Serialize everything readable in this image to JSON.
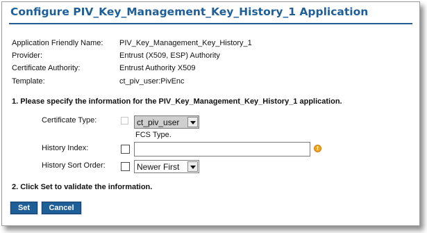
{
  "page_title": "Configure PIV_Key_Management_Key_History_1 Application",
  "details": [
    {
      "label": "Application Friendly Name:",
      "value": "PIV_Key_Management_Key_History_1"
    },
    {
      "label": "Provider:",
      "value": "Entrust (X509, ESP) Authority"
    },
    {
      "label": "Certificate Authority:",
      "value": "Entrust Authority X509"
    },
    {
      "label": "Template:",
      "value": "ct_piv_user:PivEnc"
    }
  ],
  "step1": "1. Please specify the information for the PIV_Key_Management_Key_History_1 application.",
  "fields": {
    "certificate_type": {
      "label": "Certificate Type:",
      "selected": "ct_piv_user",
      "hint": "FCS Type."
    },
    "history_index": {
      "label": "History Index:",
      "value": "",
      "warning_icon": "warning-icon",
      "warning_symbol": "!"
    },
    "history_sort_order": {
      "label": "History Sort Order:",
      "selected": "Newer First"
    }
  },
  "step2": "2. Click Set to validate the information.",
  "buttons": {
    "set": "Set",
    "cancel": "Cancel"
  },
  "colors": {
    "accent": "#1f5f98",
    "warning": "#f0a21f"
  }
}
